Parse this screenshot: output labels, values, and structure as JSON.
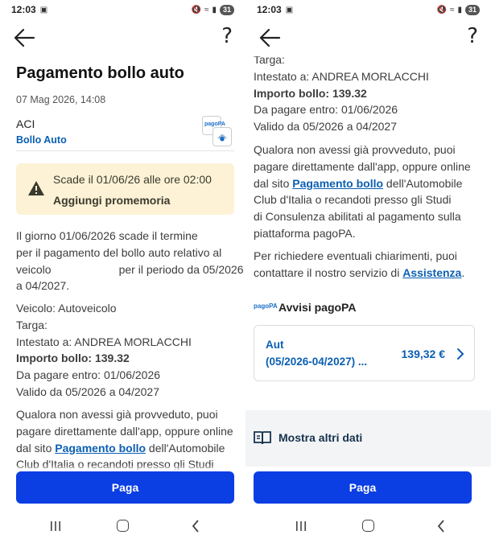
{
  "status_bar": {
    "time": "12:03",
    "battery": "31"
  },
  "left": {
    "title": "Pagamento bollo auto",
    "date": "07 Mag 2026, 14:08",
    "issuer": {
      "name": "ACI",
      "service": "Bollo Auto",
      "logo_text": "pagoPA"
    },
    "banner": {
      "text": "Scade il 01/06/26 alle ore 02:00",
      "action": "Aggiungi promemoria"
    },
    "intro_lines": [
      "Il giorno 01/06/2026 scade il termine",
      "per il pagamento del bollo auto relativo al",
      "veicolo",
      "per il periodo da 05/2026",
      "a 04/2027."
    ],
    "details": {
      "veicolo": "Veicolo: Autoveicolo",
      "targa": "Targa:",
      "intestato": "Intestato a: ANDREA MORLACCHI",
      "importo": "Importo bollo: 139.32",
      "scadenza": "Da pagare entro: 01/06/2026",
      "validita": "Valido da 05/2026 a 04/2027"
    },
    "para": {
      "l1": "Qualora non avessi già provveduto, puoi",
      "l2": "pagare direttamente dall'app, oppure online",
      "l3a": "dal sito ",
      "l3link": "Pagamento bollo",
      "l3b": " dell'Automobile",
      "l4": "Club d'Italia o recandoti presso gli Studi"
    },
    "pay_label": "Paga"
  },
  "right": {
    "details": {
      "targa": "Targa:",
      "intestato": "Intestato a: ANDREA MORLACCHI",
      "importo": "Importo bollo: 139.32",
      "scadenza": "Da pagare entro: 01/06/2026",
      "validita": "Valido da 05/2026 a 04/2027"
    },
    "para": {
      "l1": "Qualora non avessi già provveduto, puoi",
      "l2": "pagare direttamente dall'app, oppure online",
      "l3a": "dal sito ",
      "l3link": "Pagamento bollo",
      "l3b": " dell'Automobile",
      "l4": "Club d'Italia o recandoti presso gli Studi",
      "l5": "di Consulenza abilitati al pagamento sulla",
      "l6": "piattaforma pagoPA."
    },
    "help": {
      "l1": "Per richiedere eventuali chiarimenti, puoi",
      "l2a": "contattare il nostro servizio di ",
      "l2link": "Assistenza",
      "l2b": "."
    },
    "avvisi": {
      "logo_text": "pagoPA",
      "label": "Avvisi pagoPA"
    },
    "payment_card": {
      "title": "Aut",
      "period": "(05/2026-04/2027) ...",
      "amount": "139,32 €"
    },
    "more_label": "Mostra altri dati",
    "pay_label": "Paga"
  }
}
